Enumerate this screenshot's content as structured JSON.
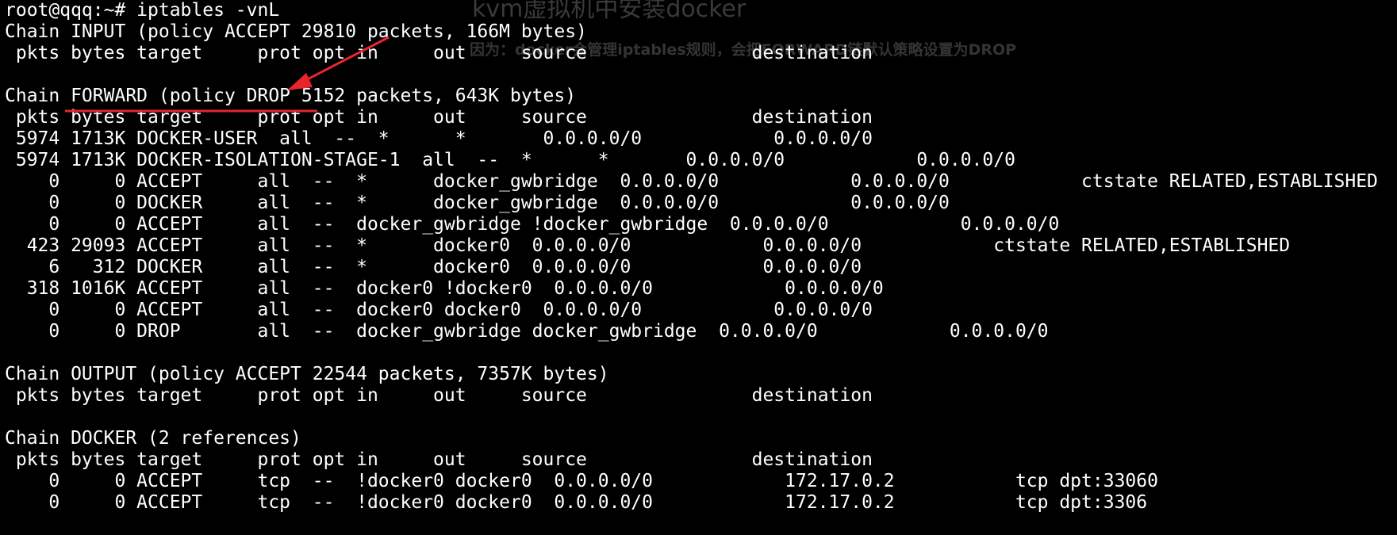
{
  "watermark": {
    "title": "kvm虚拟机中安装docker",
    "subtitle": "因为：docker会管理iptables规则，会把FORWARD链默认策略设置为DROP"
  },
  "terminal": {
    "lines": [
      "root@qqq:~# iptables -vnL",
      "Chain INPUT (policy ACCEPT 29810 packets, 166M bytes)",
      " pkts bytes target     prot opt in     out     source               destination",
      "",
      "Chain FORWARD (policy DROP 5152 packets, 643K bytes)",
      " pkts bytes target     prot opt in     out     source               destination",
      " 5974 1713K DOCKER-USER  all  --  *      *       0.0.0.0/0            0.0.0.0/0",
      " 5974 1713K DOCKER-ISOLATION-STAGE-1  all  --  *      *       0.0.0.0/0            0.0.0.0/0",
      "    0     0 ACCEPT     all  --  *      docker_gwbridge  0.0.0.0/0            0.0.0.0/0            ctstate RELATED,ESTABLISHED",
      "    0     0 DOCKER     all  --  *      docker_gwbridge  0.0.0.0/0            0.0.0.0/0",
      "    0     0 ACCEPT     all  --  docker_gwbridge !docker_gwbridge  0.0.0.0/0            0.0.0.0/0",
      "  423 29093 ACCEPT     all  --  *      docker0  0.0.0.0/0            0.0.0.0/0            ctstate RELATED,ESTABLISHED",
      "    6   312 DOCKER     all  --  *      docker0  0.0.0.0/0            0.0.0.0/0",
      "  318 1016K ACCEPT     all  --  docker0 !docker0  0.0.0.0/0            0.0.0.0/0",
      "    0     0 ACCEPT     all  --  docker0 docker0  0.0.0.0/0            0.0.0.0/0",
      "    0     0 DROP       all  --  docker_gwbridge docker_gwbridge  0.0.0.0/0            0.0.0.0/0",
      "",
      "Chain OUTPUT (policy ACCEPT 22544 packets, 7357K bytes)",
      " pkts bytes target     prot opt in     out     source               destination",
      "",
      "Chain DOCKER (2 references)",
      " pkts bytes target     prot opt in     out     source               destination",
      "    0     0 ACCEPT     tcp  --  !docker0 docker0  0.0.0.0/0            172.17.0.2           tcp dpt:33060",
      "    0     0 ACCEPT     tcp  --  !docker0 docker0  0.0.0.0/0            172.17.0.2           tcp dpt:3306"
    ]
  },
  "annotation": {
    "color": "#e8252b"
  },
  "colors": {
    "background": "#000000",
    "text": "#ffffff"
  }
}
